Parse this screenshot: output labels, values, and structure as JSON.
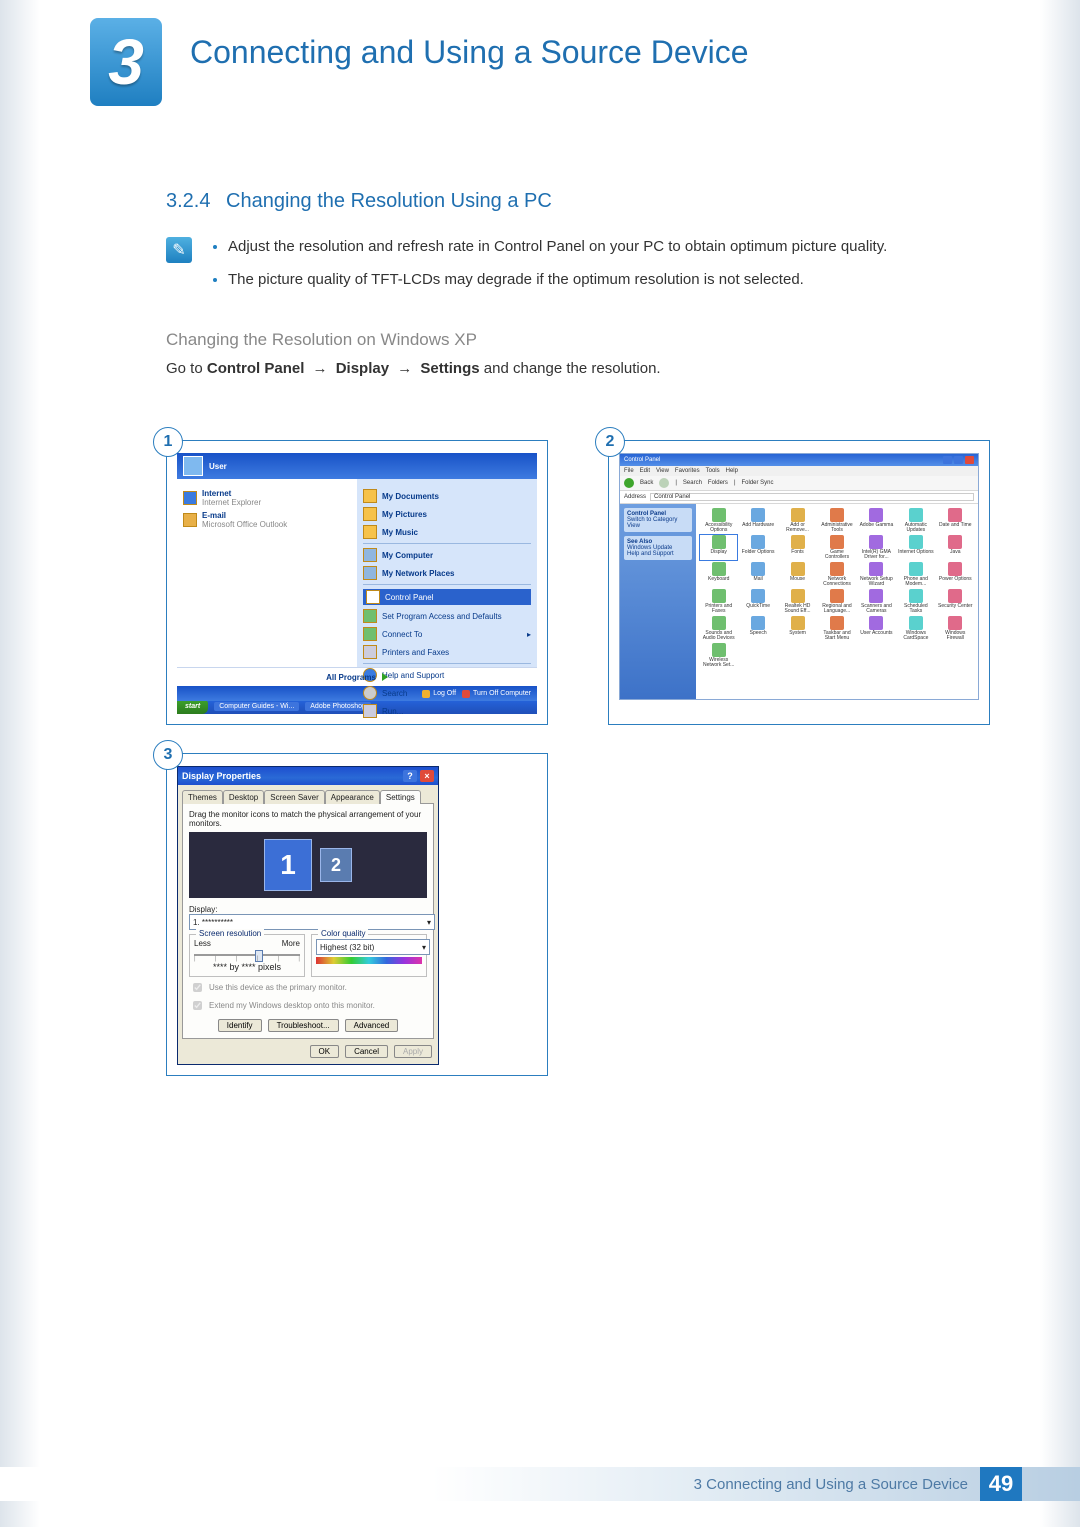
{
  "chapter": {
    "number": "3",
    "title": "Connecting and Using a Source Device"
  },
  "section": {
    "number": "3.2.4",
    "title": "Changing the Resolution Using a PC"
  },
  "notes": {
    "item1": "Adjust the resolution and refresh rate in Control Panel on your PC to obtain optimum picture quality.",
    "item2": "The picture quality of TFT-LCDs may degrade if the optimum resolution is not selected."
  },
  "subhead": "Changing the Resolution on Windows XP",
  "instruction": {
    "prefix": "Go to ",
    "p1": "Control Panel",
    "p2": "Display",
    "p3": "Settings",
    "suffix": " and change the resolution."
  },
  "badges": {
    "b1": "1",
    "b2": "2",
    "b3": "3"
  },
  "startmenu": {
    "user": "User",
    "left": {
      "internet": "Internet",
      "internet_sub": "Internet Explorer",
      "email": "E-mail",
      "email_sub": "Microsoft Office Outlook",
      "allprograms": "All Programs"
    },
    "right": {
      "mydocs": "My Documents",
      "mypics": "My Pictures",
      "mymusic": "My Music",
      "mycomp": "My Computer",
      "netplaces": "My Network Places",
      "cpanel": "Control Panel",
      "setaccess": "Set Program Access and Defaults",
      "connect": "Connect To",
      "printers": "Printers and Faxes",
      "help": "Help and Support",
      "search": "Search",
      "run": "Run..."
    },
    "footer": {
      "logoff": "Log Off",
      "turnoff": "Turn Off Computer"
    },
    "taskbar": {
      "start": "start",
      "t1": "Computer Guides - Wi...",
      "t2": "Adobe Photoshop"
    }
  },
  "controlpanel": {
    "title": "Control Panel",
    "menu": {
      "file": "File",
      "edit": "Edit",
      "view": "View",
      "fav": "Favorites",
      "tools": "Tools",
      "help": "Help"
    },
    "toolbar": {
      "back": "Back",
      "search": "Search",
      "folders": "Folders",
      "foldersync": "Folder Sync"
    },
    "address_label": "Address",
    "address_value": "Control Panel",
    "side": {
      "heading": "Control Panel",
      "switch": "Switch to Category View",
      "seealso": "See Also",
      "winupdate": "Windows Update",
      "helpsupport": "Help and Support"
    },
    "icons": [
      "Accessibility Options",
      "Add Hardware",
      "Add or Remove...",
      "Administrative Tools",
      "Adobe Gamma",
      "Automatic Updates",
      "Date and Time",
      "Display",
      "Folder Options",
      "Fonts",
      "Game Controllers",
      "Intel(R) GMA Driver for...",
      "Internet Options",
      "Java",
      "Keyboard",
      "Mail",
      "Mouse",
      "Network Connections",
      "Network Setup Wizard",
      "Phone and Modem...",
      "Power Options",
      "Printers and Faxes",
      "QuickTime",
      "Realtek HD Sound Eff...",
      "Regional and Language...",
      "Scanners and Cameras",
      "Scheduled Tasks",
      "Security Center",
      "Sounds and Audio Devices",
      "Speech",
      "System",
      "Taskbar and Start Menu",
      "User Accounts",
      "Windows CardSpace",
      "Windows Firewall",
      "Wireless Network Set..."
    ]
  },
  "displayprops": {
    "title": "Display Properties",
    "tabs": {
      "themes": "Themes",
      "desktop": "Desktop",
      "saver": "Screen Saver",
      "appearance": "Appearance",
      "settings": "Settings"
    },
    "active_tab": "settings",
    "drag_hint": "Drag the monitor icons to match the physical arrangement of your monitors.",
    "mon1": "1",
    "mon2": "2",
    "display_label": "Display:",
    "display_value": "1. **********",
    "res_group": "Screen resolution",
    "res_less": "Less",
    "res_more": "More",
    "res_value": "**** by **** pixels",
    "color_group": "Color quality",
    "color_value": "Highest (32 bit)",
    "chk_primary": "Use this device as the primary monitor.",
    "chk_extend": "Extend my Windows desktop onto this monitor.",
    "btn_identify": "Identify",
    "btn_troubleshoot": "Troubleshoot...",
    "btn_advanced": "Advanced",
    "btn_ok": "OK",
    "btn_cancel": "Cancel",
    "btn_apply": "Apply"
  },
  "footer": {
    "chapter_label": "3 Connecting and Using a Source Device",
    "page": "49"
  }
}
